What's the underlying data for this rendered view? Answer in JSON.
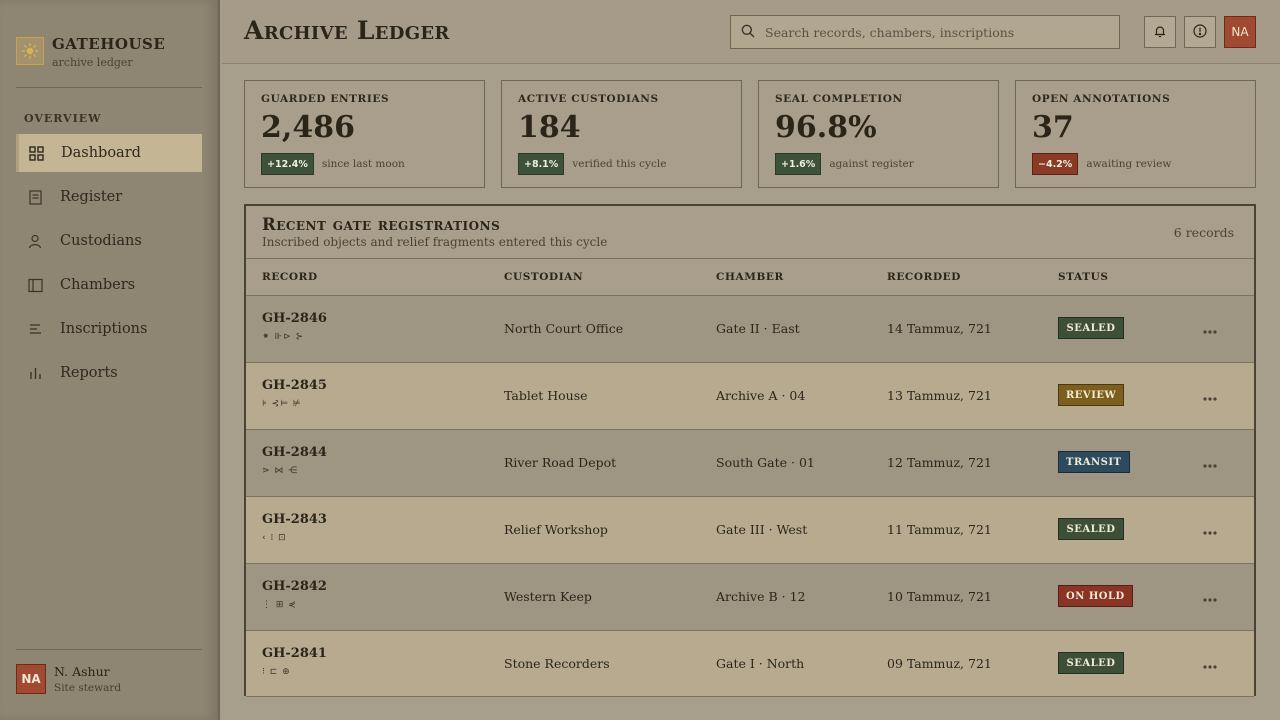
{
  "brand": {
    "name": "GATEHOUSE",
    "subtitle": "archive ledger"
  },
  "sidebar": {
    "section": "OVERVIEW",
    "items": [
      {
        "label": "Dashboard",
        "icon": "grid-icon",
        "active": true
      },
      {
        "label": "Register",
        "icon": "document-icon"
      },
      {
        "label": "Custodians",
        "icon": "person-icon"
      },
      {
        "label": "Chambers",
        "icon": "columns-icon"
      },
      {
        "label": "Inscriptions",
        "icon": "lines-icon"
      },
      {
        "label": "Reports",
        "icon": "bars-icon"
      }
    ]
  },
  "user": {
    "initials": "NA",
    "name": "N. Ashur",
    "role": "Site steward"
  },
  "header": {
    "title": "Archive Ledger",
    "search_placeholder": "Search records, chambers, inscriptions",
    "avatar_initials": "NA"
  },
  "stats": [
    {
      "label": "GUARDED ENTRIES",
      "value": "2,486",
      "delta": "+12.4%",
      "trend": "up",
      "note": "since last moon"
    },
    {
      "label": "ACTIVE CUSTODIANS",
      "value": "184",
      "delta": "+8.1%",
      "trend": "up",
      "note": "verified this cycle"
    },
    {
      "label": "SEAL COMPLETION",
      "value": "96.8%",
      "delta": "+1.6%",
      "trend": "up",
      "note": "against register"
    },
    {
      "label": "OPEN ANNOTATIONS",
      "value": "37",
      "delta": "−4.2%",
      "trend": "down",
      "note": "awaiting review"
    }
  ],
  "table": {
    "title": "Recent gate registrations",
    "subtitle": "Inscribed objects and relief fragments entered this cycle",
    "count": "6 records",
    "columns": [
      "RECORD",
      "CUSTODIAN",
      "CHAMBER",
      "RECORDED",
      "STATUS"
    ],
    "rows": [
      {
        "id": "GH-2846",
        "glyph": "⁕ ⊪⊳ ⊱",
        "custodian": "North Court Office",
        "chamber": "Gate II · East",
        "recorded": "14 Tammuz, 721",
        "status": "SEALED",
        "status_color": "#3e4f38"
      },
      {
        "id": "GH-2845",
        "glyph": "⊧ ⊰⊨ ⊭",
        "custodian": "Tablet House",
        "chamber": "Archive A · 04",
        "recorded": "13 Tammuz, 721",
        "status": "REVIEW",
        "status_color": "#7d5f1d"
      },
      {
        "id": "GH-2844",
        "glyph": "⋗ ⋈ ⋲",
        "custodian": "River Road Depot",
        "chamber": "South Gate · 01",
        "recorded": "12 Tammuz, 721",
        "status": "TRANSIT",
        "status_color": "#2e4a5e"
      },
      {
        "id": "GH-2843",
        "glyph": "‹ ⁞ ⊡",
        "custodian": "Relief Workshop",
        "chamber": "Gate III · West",
        "recorded": "11 Tammuz, 721",
        "status": "SEALED",
        "status_color": "#3e4f38"
      },
      {
        "id": "GH-2842",
        "glyph": "⋮ ⊞ ⋞",
        "custodian": "Western Keep",
        "chamber": "Archive B · 12",
        "recorded": "10 Tammuz, 721",
        "status": "ON HOLD",
        "status_color": "#8a3425"
      },
      {
        "id": "GH-2841",
        "glyph": "⁝ ⊏ ⊕",
        "custodian": "Stone Recorders",
        "chamber": "Gate I · North",
        "recorded": "09 Tammuz, 721",
        "status": "SEALED",
        "status_color": "#3e4f38"
      }
    ]
  }
}
